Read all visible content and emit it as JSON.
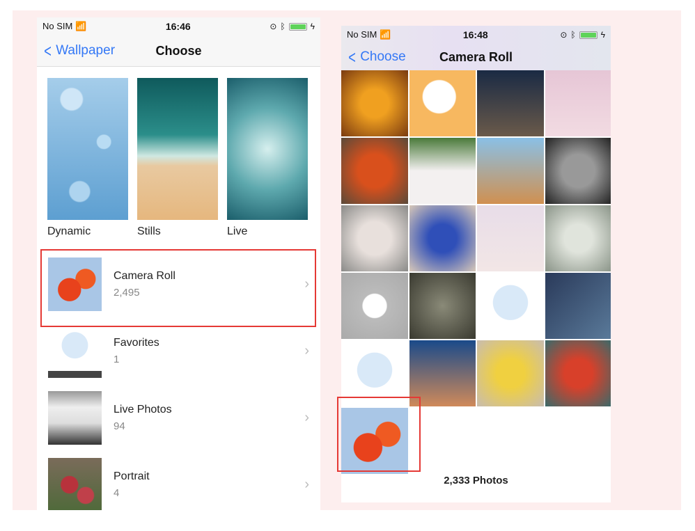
{
  "left": {
    "status": {
      "carrier": "No SIM",
      "time": "16:46"
    },
    "nav": {
      "back": "Wallpaper",
      "title": "Choose"
    },
    "categories": [
      {
        "label": "Dynamic"
      },
      {
        "label": "Stills"
      },
      {
        "label": "Live"
      }
    ],
    "albums": [
      {
        "name": "Camera Roll",
        "count": "2,495",
        "highlighted": true
      },
      {
        "name": "Favorites",
        "count": "1"
      },
      {
        "name": "Live Photos",
        "count": "94"
      },
      {
        "name": "Portrait",
        "count": "4"
      }
    ]
  },
  "right": {
    "status": {
      "carrier": "No SIM",
      "time": "16:48"
    },
    "nav": {
      "back": "Choose",
      "title": "Camera Roll"
    },
    "photo_count": "2,333 Photos",
    "highlight_color": "#e53935"
  }
}
